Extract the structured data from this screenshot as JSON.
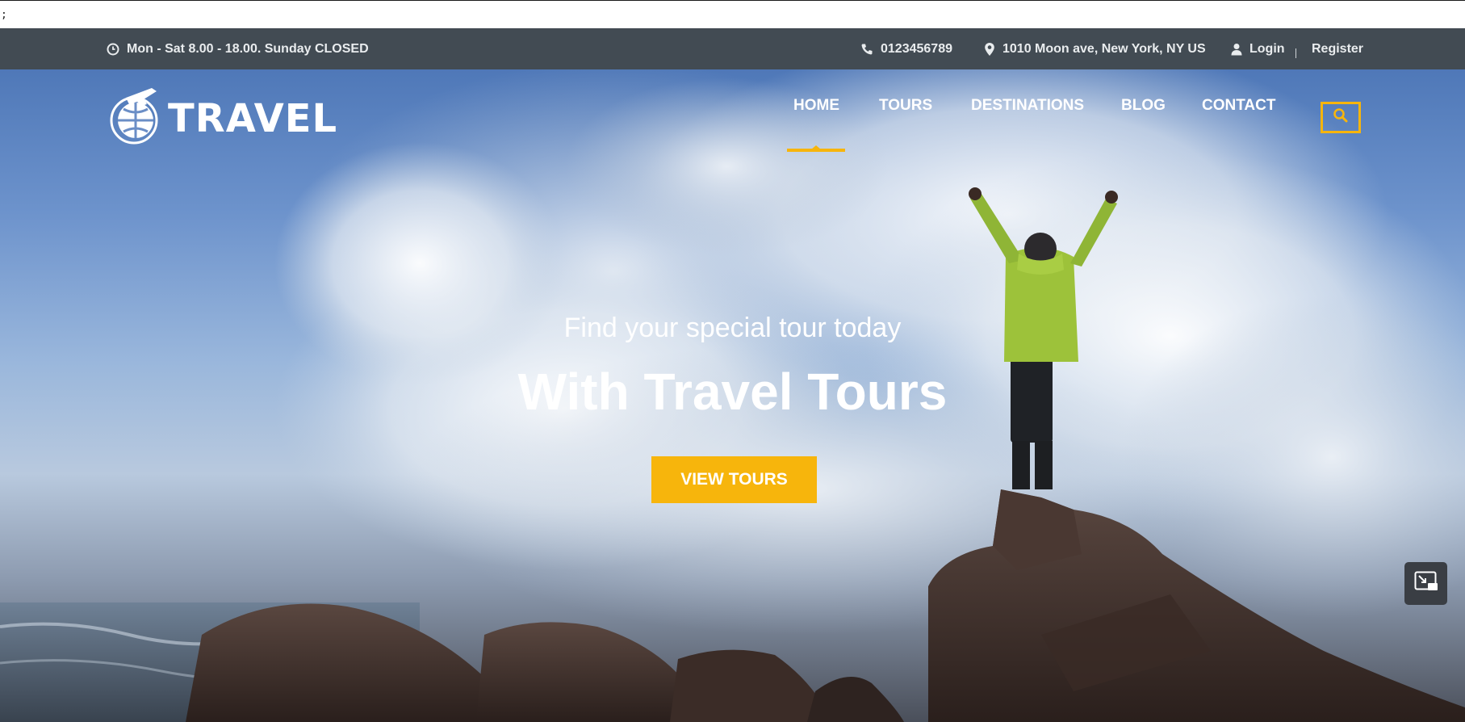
{
  "stray_text": ";",
  "topbar": {
    "hours": "Mon - Sat 8.00 - 18.00. Sunday CLOSED",
    "phone": "0123456789",
    "address": "1010 Moon ave, New York, NY US",
    "login": "Login",
    "register": "Register"
  },
  "brand": {
    "name": "TRAVEL"
  },
  "nav": {
    "items": [
      {
        "label": "HOME",
        "active": true
      },
      {
        "label": "TOURS"
      },
      {
        "label": "DESTINATIONS"
      },
      {
        "label": "BLOG"
      },
      {
        "label": "CONTACT"
      }
    ]
  },
  "hero": {
    "subtitle": "Find your special tour today",
    "title": "With Travel Tours",
    "cta": "VIEW TOURS"
  },
  "colors": {
    "accent": "#f7b50c",
    "topbar_bg": "#424b53"
  },
  "icons": [
    "clock-icon",
    "phone-icon",
    "map-pin-icon",
    "user-icon",
    "globe-plane-logo-icon",
    "search-icon",
    "picture-in-picture-icon"
  ]
}
